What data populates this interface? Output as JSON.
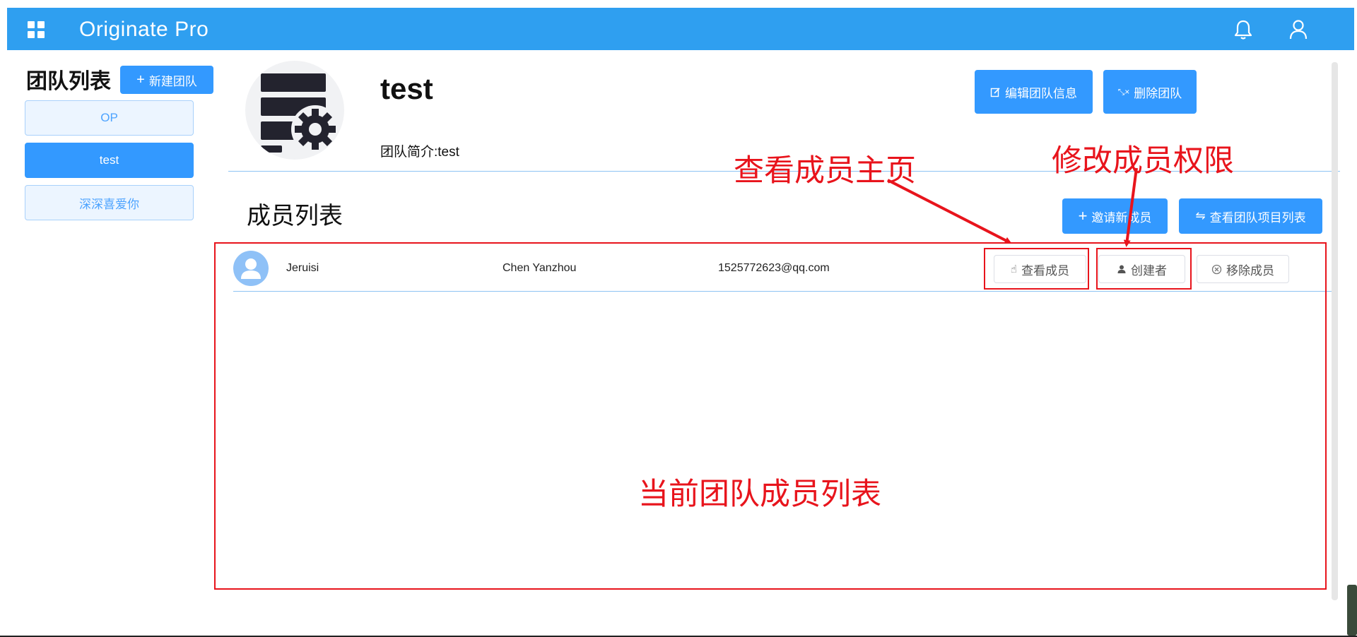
{
  "header": {
    "app_title": "Originate Pro",
    "menu_icon": "apps-grid-icon",
    "bell_icon": "bell-icon",
    "user_icon": "user-icon",
    "bg_color": "#2f9ff0"
  },
  "sidebar": {
    "title": "团队列表",
    "new_team_label": "新建团队",
    "teams": [
      {
        "label": "OP",
        "active": false
      },
      {
        "label": "test",
        "active": true
      },
      {
        "label": "深深喜爱你",
        "active": false
      }
    ]
  },
  "team": {
    "name": "test",
    "description": "团队简介:test",
    "edit_label": "编辑团队信息",
    "delete_label": "删除团队"
  },
  "members_section": {
    "title": "成员列表",
    "invite_label": "邀请新成员",
    "projects_label": "查看团队项目列表",
    "members": [
      {
        "username": "Jeruisi",
        "full_name": "Chen Yanzhou",
        "email": "1525772623@qq.com",
        "view_label": "查看成员",
        "role_label": "创建者",
        "remove_label": "移除成员"
      }
    ]
  },
  "annotations": {
    "view_member_homepage": "查看成员主页",
    "modify_member_permission": "修改成员权限",
    "current_member_list": "当前团队成员列表",
    "color": "#e8141c"
  },
  "colors": {
    "primary": "#3399ff",
    "divider": "#8ec3f3",
    "team_item_bg": "#ecf5ff"
  }
}
